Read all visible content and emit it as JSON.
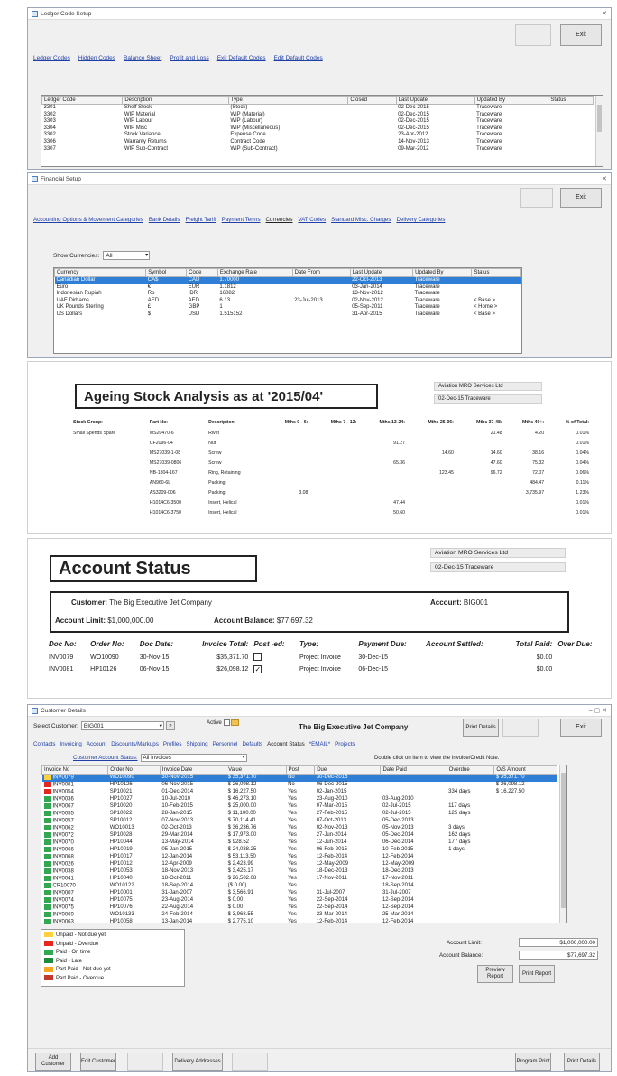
{
  "ledger": {
    "title": "Ledger Code Setup",
    "exit_label": "Exit",
    "tabs": [
      "Ledger Codes",
      "Hidden Codes",
      "Balance Sheet",
      "Profit and Loss",
      "Exit Default Codes",
      "Edit Default Codes"
    ],
    "columns": [
      "Ledger Code",
      "Description",
      "Type",
      "Closed",
      "Last Update",
      "Updated By",
      "Status"
    ],
    "rows": [
      [
        "3301",
        "Shelf Stock",
        "(Stock)",
        "",
        "02-Dec-2015",
        "Traceware",
        ""
      ],
      [
        "3302",
        "WIP Material",
        "WIP (Material)",
        "",
        "02-Dec-2015",
        "Traceware",
        ""
      ],
      [
        "3303",
        "WIP Labour",
        "WIP (Labour)",
        "",
        "02-Dec-2015",
        "Traceware",
        ""
      ],
      [
        "3304",
        "WIP Misc",
        "WIP (Miscellaneous)",
        "",
        "02-Dec-2015",
        "Traceware",
        ""
      ],
      [
        "3302",
        "Stock Variance",
        "Expense Code",
        "",
        "23-Apr-2012",
        "Traceware",
        ""
      ],
      [
        "3306",
        "Warranty Returns",
        "Contract Code",
        "",
        "14-Nov-2013",
        "Traceware",
        ""
      ],
      [
        "3307",
        "WIP Sub-Contract",
        "WIP (Sub-Contract)",
        "",
        "09-Mar-2012",
        "Traceware",
        ""
      ]
    ]
  },
  "financial": {
    "title": "Financial Setup",
    "exit_label": "Exit",
    "tabs": [
      "Accounting Options & Movement Categories",
      "Bank Details",
      "Freight Tariff",
      "Payment Terms",
      "Currencies",
      "VAT Codes",
      "Standard Misc. Charges",
      "Delivery Categories"
    ],
    "filter_label": "Show Currencies:",
    "filter_value": "All",
    "columns": [
      "Currency",
      "Symbol",
      "Code",
      "Exchange Rate",
      "Date From",
      "Last Update",
      "Updated By",
      "Status"
    ],
    "rows": [
      [
        "Canadian Dollar",
        "CA$",
        "CAD",
        "1.70000",
        "",
        "22-Oct-2013",
        "Traceware",
        ""
      ],
      [
        "Euro",
        "€",
        "EUR",
        "1.1812",
        "",
        "03-Jan-2014",
        "Traceware",
        ""
      ],
      [
        "Indonesian Rupiah",
        "Rp",
        "IDR",
        "16082",
        "",
        "13-Nov-2012",
        "Traceware",
        ""
      ],
      [
        "UAE Dirhams",
        "AED",
        "AED",
        "6.13",
        "23-Jul-2013",
        "02-Nov-2012",
        "Traceware",
        "< Base >"
      ],
      [
        "UK Pounds Sterling",
        "£",
        "GBP",
        "1",
        "",
        "05-Sep-2011",
        "Traceware",
        "< Home >"
      ],
      [
        "US Dollars",
        "$",
        "USD",
        "1.515152",
        "",
        "31-Apr-2015",
        "Traceware",
        "< Base >"
      ]
    ]
  },
  "ageing": {
    "title": "Ageing Stock Analysis as at '2015/04'",
    "company": "Aviation MRO Services Ltd",
    "date_user": "02-Dec-15   Traceware",
    "headers": [
      "Stock Group:",
      "Part No:",
      "Description:",
      "Mths 0 - 6:",
      "Mths 7 - 12:",
      "Mths 13-24:",
      "Mths 25-36:",
      "Mths 37-48:",
      "Mths 49+:",
      "% of Total:"
    ],
    "rows": [
      [
        "Small Spends Spare",
        "MS20470-6",
        "Rivet",
        "",
        "",
        "",
        "",
        "21.48",
        "4.20",
        "0.01%"
      ],
      [
        "",
        "CF2096-04",
        "Nut",
        "",
        "",
        "91.27",
        "",
        "",
        "",
        "0.01%"
      ],
      [
        "",
        "MS27039-1-08",
        "Screw",
        "",
        "",
        "",
        "14.60",
        "14.60",
        "38.16",
        "0.04%"
      ],
      [
        "",
        "MS27039-0806",
        "Screw",
        "",
        "",
        "65.36",
        "",
        "47.60",
        "75.32",
        "0.04%"
      ],
      [
        "",
        "NB-1804-167",
        "Ring, Retaining",
        "",
        "",
        "",
        "123.45",
        "96.72",
        "72.07",
        "0.06%"
      ],
      [
        "",
        "AN960-6L",
        "Packing",
        "",
        "",
        "",
        "",
        "",
        "484.47",
        "0.11%"
      ],
      [
        "",
        "AS3209-006",
        "Packing",
        "3.08",
        "",
        "",
        "",
        "",
        "3,735.97",
        "1.23%"
      ],
      [
        "",
        "H1014C6-3500",
        "Insert, Helical",
        "",
        "",
        "47.44",
        "",
        "",
        "",
        "0.01%"
      ],
      [
        "",
        "H1014C6-3750",
        "Insert, Helical",
        "",
        "",
        "50.60",
        "",
        "",
        "",
        "0.01%"
      ]
    ]
  },
  "account": {
    "title": "Account Status",
    "company": "Aviation MRO Services Ltd",
    "date_user": "02-Dec-15   Traceware",
    "customer_label": "Customer:",
    "customer_value": "The Big Executive Jet Company",
    "account_label": "Account:",
    "account_value": "BIG001",
    "limit_label": "Account Limit:",
    "limit_value": "$1,000,000.00",
    "balance_label": "Account Balance:",
    "balance_value": "$77,697.32",
    "headers": [
      "Doc No:",
      "Order No:",
      "Doc Date:",
      "Invoice Total:",
      "Post -ed:",
      "Type:",
      "Payment Due:",
      "Account Settled:",
      "Total Paid:",
      "Over Due:"
    ],
    "rows": [
      [
        "INV0079",
        "WO10090",
        "30-Nov-15",
        "$35,371.70",
        false,
        "Project Invoice",
        "30-Dec-15",
        "",
        "$0.00",
        ""
      ],
      [
        "INV0081",
        "HP10126",
        "06-Nov-15",
        "$26,098.12",
        true,
        "Project Invoice",
        "06-Dec-15",
        "",
        "$0.00",
        ""
      ]
    ]
  },
  "customer": {
    "title": "Customer Details",
    "select_label": "Select Customer:",
    "select_value": "BIG001",
    "active_label": "Active",
    "company_name": "The Big Executive Jet Company",
    "print_label": "Print Details",
    "exit_label": "Exit",
    "tabs": [
      "Contacts",
      "Invoicing",
      "Account",
      "Discounts/Markups",
      "Profiles",
      "Shipping",
      "Personnel",
      "Defaults",
      "Account Status",
      "*EMAIL*",
      "Projects"
    ],
    "view_label": "Customer Account Status:",
    "view_value": "All Invoices",
    "hint": "Double click on item to view the Invoice/Credit Note.",
    "columns": [
      "Invoice No",
      "Order No",
      "Invoice Date",
      "Value",
      "Post",
      "Due",
      "Date Paid",
      "Overdue",
      "O/S Amount"
    ],
    "rows": [
      [
        "#ffd23c",
        "INV0079",
        "WO10090",
        "30-Nov-2015",
        "$ 35,371.70",
        "No",
        "30-Dec-2015",
        "",
        "",
        "$ 35,371.70"
      ],
      [
        "#e6261f",
        "INV0081",
        "HP10126",
        "06-Nov-2015",
        "$ 26,098.12",
        "No",
        "06-Dec-2015",
        "",
        "",
        "$ 26,098.12"
      ],
      [
        "#e6261f",
        "INV0054",
        "SP10021",
        "01-Dec-2014",
        "$ 16,227.50",
        "Yes",
        "02-Jan-2015",
        "",
        "334 days",
        "$ 16,227.50"
      ],
      [
        "#32a852",
        "INV0036",
        "HP10027",
        "10-Jul-2010",
        "$ 46,273.10",
        "Yes",
        "23-Aug-2010",
        "03-Aug-2010",
        "",
        ""
      ],
      [
        "#32a852",
        "INV0067",
        "SP10020",
        "10-Feb-2015",
        "$ 25,000.00",
        "Yes",
        "07-Mar-2015",
        "02-Jul-2015",
        "117 days",
        ""
      ],
      [
        "#32a852",
        "INV0055",
        "SP10022",
        "28-Jan-2015",
        "$ 11,100.00",
        "Yes",
        "27-Feb-2015",
        "02-Jul-2015",
        "125 days",
        ""
      ],
      [
        "#32a852",
        "INV0057",
        "SP10012",
        "07-Nov-2013",
        "$ 70,114.41",
        "Yes",
        "07-Oct-2013",
        "05-Dec-2013",
        "",
        ""
      ],
      [
        "#32a852",
        "INV0062",
        "WO10013",
        "02-Oct-2013",
        "$ 36,236.76",
        "Yes",
        "02-Nov-2013",
        "05-Nov-2013",
        "3 days",
        ""
      ],
      [
        "#32a852",
        "INV0072",
        "SP10028",
        "29-Mar-2014",
        "$ 17,973.00",
        "Yes",
        "27-Jun-2014",
        "05-Dec-2014",
        "162 days",
        ""
      ],
      [
        "#32a852",
        "INV0070",
        "HP10044",
        "13-May-2014",
        "$ 928.52",
        "Yes",
        "12-Jun-2014",
        "06-Dec-2014",
        "177 days",
        ""
      ],
      [
        "#32a852",
        "INV0066",
        "HP10019",
        "05-Jan-2015",
        "$ 24,038.25",
        "Yes",
        "06-Feb-2015",
        "10-Feb-2015",
        "1 days",
        ""
      ],
      [
        "#32a852",
        "INV0068",
        "HP10017",
        "12-Jan-2014",
        "$ 53,113.50",
        "Yes",
        "12-Feb-2014",
        "12-Feb-2014",
        "",
        ""
      ],
      [
        "#32a852",
        "INV0026",
        "HP10012",
        "12-Apr-2009",
        "$ 2,423.99",
        "Yes",
        "12-May-2009",
        "12-May-2009",
        "",
        ""
      ],
      [
        "#32a852",
        "INV0038",
        "HP10053",
        "18-Nov-2013",
        "$ 3,425.17",
        "Yes",
        "18-Dec-2013",
        "18-Dec-2013",
        "",
        ""
      ],
      [
        "#32a852",
        "INV0041",
        "HP10040",
        "18-Oct-2011",
        "$ 26,502.08",
        "Yes",
        "17-Nov-2011",
        "17-Nov-2011",
        "",
        ""
      ],
      [
        "#32a852",
        "CR10070",
        "WO10122",
        "18-Sep-2014",
        "($ 0.00)",
        "Yes",
        "",
        "18-Sep-2014",
        "",
        ""
      ],
      [
        "#32a852",
        "INV0007",
        "HP10001",
        "31-Jan-2007",
        "$ 3,566.91",
        "Yes",
        "31-Jul-2007",
        "31-Jul-2007",
        "",
        ""
      ],
      [
        "#32a852",
        "INV0074",
        "HP10075",
        "23-Aug-2014",
        "$ 0.00",
        "Yes",
        "22-Sep-2014",
        "12-Sep-2014",
        "",
        ""
      ],
      [
        "#32a852",
        "INV0075",
        "HP10076",
        "22-Aug-2014",
        "$ 0.00",
        "Yes",
        "22-Sep-2014",
        "12-Sep-2014",
        "",
        ""
      ],
      [
        "#32a852",
        "INV0069",
        "WO10133",
        "24-Feb-2014",
        "$ 3,968.55",
        "Yes",
        "23-Mar-2014",
        "25-Mar-2014",
        "",
        ""
      ],
      [
        "#32a852",
        "INV0063",
        "HP10058",
        "13-Jan-2014",
        "$ 2,775.10",
        "Yes",
        "12-Feb-2014",
        "12-Feb-2014",
        "",
        ""
      ]
    ],
    "legend": [
      {
        "color": "#ffd23c",
        "label": "Unpaid - Not due yet"
      },
      {
        "color": "#e6261f",
        "label": "Unpaid - Overdue"
      },
      {
        "color": "#32a852",
        "label": "Paid - On time"
      },
      {
        "color": "#1e8a3c",
        "label": "Paid - Late"
      },
      {
        "color": "#f5a623",
        "label": "Part Paid - Not due yet"
      },
      {
        "color": "#c0392b",
        "label": "Part Paid - Overdue"
      }
    ],
    "limit_label": "Account Limit:",
    "limit_value": "$1,000,000.00",
    "balance_label": "Account Balance:",
    "balance_value": "$77,697.32",
    "preview_label": "Preview Report",
    "print_report_label": "Print Report",
    "bottom_buttons": [
      "Add Customer",
      "Edit Customer",
      "",
      "Delivery Addresses",
      "",
      "Program Print",
      "Print Details"
    ]
  }
}
